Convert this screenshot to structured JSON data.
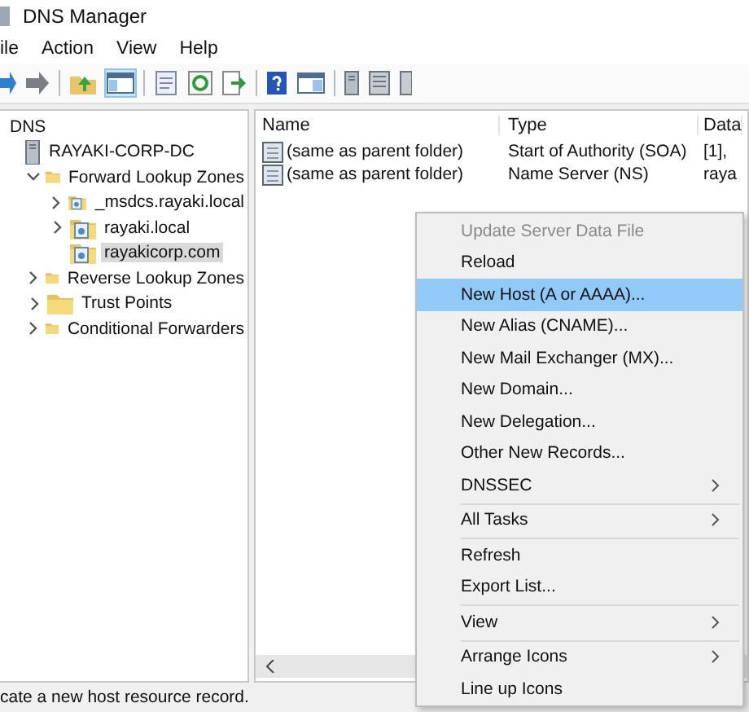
{
  "window": {
    "title": "DNS Manager"
  },
  "menu_bar": [
    "ile",
    "Action",
    "View",
    "Help"
  ],
  "tree": [
    {
      "label": "DNS",
      "kind": "root",
      "expandable": false,
      "selected": false,
      "children": [
        {
          "label": "RAYAKI-CORP-DC",
          "kind": "server",
          "expandable": false,
          "selected": false,
          "children": [
            {
              "label": "Forward Lookup Zones",
              "kind": "folder",
              "expandable": true,
              "expanded": true,
              "selected": false,
              "children": [
                {
                  "label": "_msdcs.rayaki.local",
                  "kind": "zone",
                  "expandable": true,
                  "expanded": false,
                  "selected": false
                },
                {
                  "label": "rayaki.local",
                  "kind": "zone",
                  "expandable": true,
                  "expanded": false,
                  "selected": false
                },
                {
                  "label": "rayakicorp.com",
                  "kind": "zone",
                  "expandable": false,
                  "selected": true
                }
              ]
            },
            {
              "label": "Reverse Lookup Zones",
              "kind": "folder",
              "expandable": true,
              "expanded": false,
              "selected": false
            },
            {
              "label": "Trust Points",
              "kind": "folder",
              "expandable": true,
              "expanded": false,
              "selected": false
            },
            {
              "label": "Conditional Forwarders",
              "kind": "folder",
              "expandable": true,
              "expanded": false,
              "selected": false
            }
          ]
        }
      ]
    }
  ],
  "table": {
    "columns": [
      "Name",
      "Type",
      "Data"
    ],
    "rows": [
      {
        "name": "(same as parent folder)",
        "type": "Start of Authority (SOA)",
        "data": "[1],"
      },
      {
        "name": "(same as parent folder)",
        "type": "Name Server (NS)",
        "data": "raya"
      }
    ]
  },
  "context_menu": [
    {
      "label": "Update Server Data File",
      "disabled": true,
      "selected": false,
      "submenu": false,
      "separator_after": false
    },
    {
      "label": "Reload",
      "disabled": false,
      "selected": false,
      "submenu": false,
      "separator_after": false
    },
    {
      "label": "New Host (A or AAAA)...",
      "disabled": false,
      "selected": true,
      "submenu": false,
      "separator_after": false
    },
    {
      "label": "New Alias (CNAME)...",
      "disabled": false,
      "selected": false,
      "submenu": false,
      "separator_after": false
    },
    {
      "label": "New Mail Exchanger (MX)...",
      "disabled": false,
      "selected": false,
      "submenu": false,
      "separator_after": false
    },
    {
      "label": "New Domain...",
      "disabled": false,
      "selected": false,
      "submenu": false,
      "separator_after": false
    },
    {
      "label": "New Delegation...",
      "disabled": false,
      "selected": false,
      "submenu": false,
      "separator_after": false
    },
    {
      "label": "Other New Records...",
      "disabled": false,
      "selected": false,
      "submenu": false,
      "separator_after": false
    },
    {
      "label": "DNSSEC",
      "disabled": false,
      "selected": false,
      "submenu": true,
      "separator_after": true
    },
    {
      "label": "All Tasks",
      "disabled": false,
      "selected": false,
      "submenu": true,
      "separator_after": true
    },
    {
      "label": "Refresh",
      "disabled": false,
      "selected": false,
      "submenu": false,
      "separator_after": false
    },
    {
      "label": "Export List...",
      "disabled": false,
      "selected": false,
      "submenu": false,
      "separator_after": true
    },
    {
      "label": "View",
      "disabled": false,
      "selected": false,
      "submenu": true,
      "separator_after": true
    },
    {
      "label": "Arrange Icons",
      "disabled": false,
      "selected": false,
      "submenu": true,
      "separator_after": false
    },
    {
      "label": "Line up Icons",
      "disabled": false,
      "selected": false,
      "submenu": false,
      "separator_after": false
    }
  ],
  "status_bar": "cate a new host resource record."
}
